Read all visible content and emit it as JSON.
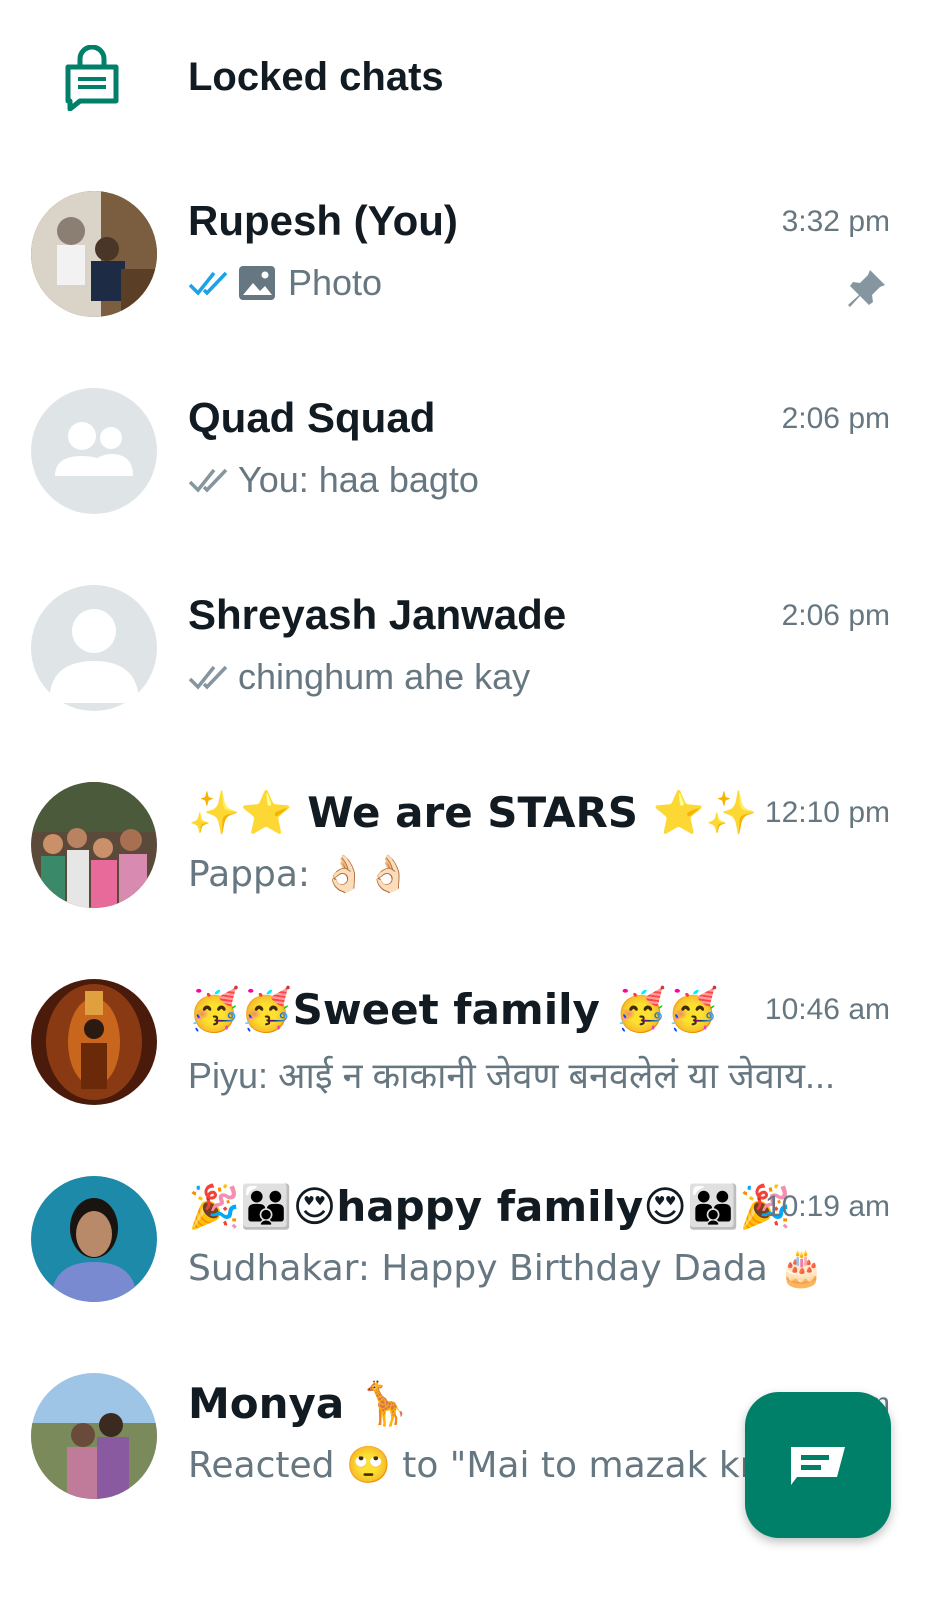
{
  "locked": {
    "label": "Locked chats",
    "icon": "locked-chat-icon",
    "accent": "#008069"
  },
  "chats": [
    {
      "name": "Rupesh (You)",
      "time": "3:32 pm",
      "status": "read",
      "preview_type": "photo",
      "preview": "Photo",
      "pinned": true
    },
    {
      "name": "Quad Squad",
      "time": "2:06 pm",
      "status": "delivered",
      "preview": "You: haa bagto"
    },
    {
      "name": "Shreyash Janwade",
      "time": "2:06 pm",
      "status": "delivered",
      "preview": "chinghum ahe kay"
    },
    {
      "name": "✨⭐ We are STARS ⭐✨",
      "time": "12:10 pm",
      "preview": "Pappa: 👌🏻👌🏻"
    },
    {
      "name": "🥳🥳Sweet family 🥳🥳",
      "time": "10:46 am",
      "preview": "Piyu: आई न काकानी जेवण बनवलेलं या जेवाय..."
    },
    {
      "name": "🎉👪😍happy family😍👪🎉",
      "time": "10:19 am",
      "preview": "Sudhakar: Happy Birthday Dada 🎂"
    },
    {
      "name": "Monya 🦒",
      "time": "10:00 am",
      "preview": "Reacted 🙄 to \"Mai to mazak kr F"
    }
  ],
  "fab": {
    "icon": "new-chat-icon",
    "color": "#008069"
  }
}
